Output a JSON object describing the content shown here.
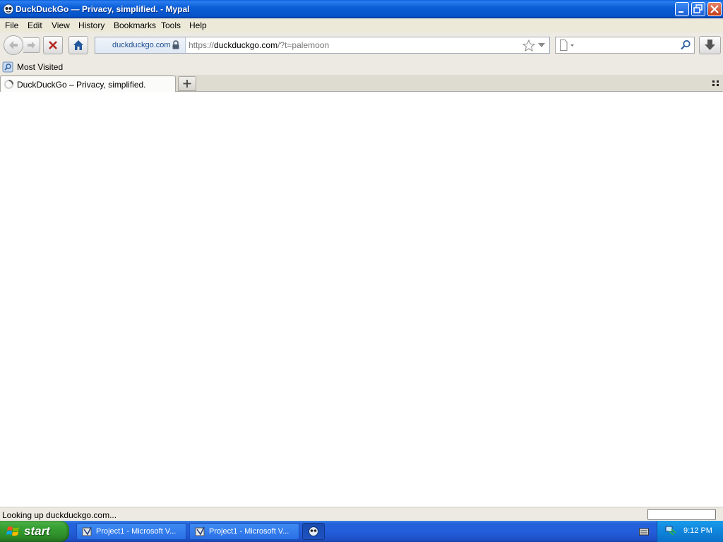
{
  "window": {
    "title": "DuckDuckGo — Privacy, simplified. - Mypal"
  },
  "menu": {
    "items": [
      "File",
      "Edit",
      "View",
      "History",
      "Bookmarks",
      "Tools",
      "Help"
    ]
  },
  "navigation": {
    "identity_label": "duckduckgo.com",
    "url_prefix": "https://",
    "url_domain": "duckduckgo.com",
    "url_suffix": "/?t=palemoon",
    "search_value": ""
  },
  "bookmarks": {
    "items": [
      "Most Visited"
    ]
  },
  "tabs": {
    "active_title": "DuckDuckGo – Privacy, simplified."
  },
  "status": {
    "text": "Looking up duckduckgo.com..."
  },
  "taskbar": {
    "start_label": "start",
    "tasks": [
      "Project1 - Microsoft V...",
      "Project1 - Microsoft V..."
    ],
    "clock": "9:12 PM"
  },
  "colors": {
    "titlebar": "#0b5ed6",
    "taskbar": "#245edb",
    "start_button": "#37a232",
    "chrome_background": "#eceae2"
  }
}
